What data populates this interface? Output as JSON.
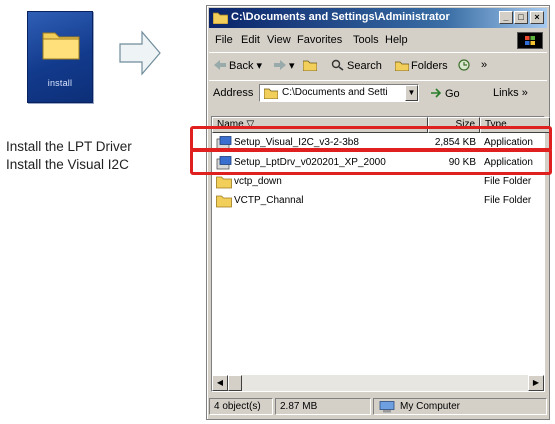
{
  "install_tile": {
    "label": "install"
  },
  "captions": [
    "Install the LPT Driver",
    "Install the Visual I2C"
  ],
  "window": {
    "title": "C:\\Documents and Settings\\Administrator",
    "menu": [
      "File",
      "Edit",
      "View",
      "Favorites",
      "Tools",
      "Help"
    ],
    "toolbar": {
      "back": "Back",
      "search": "Search",
      "folders": "Folders"
    },
    "address": {
      "label": "Address",
      "value": "C:\\Documents and Setti",
      "go": "Go",
      "links": "Links"
    },
    "columns": {
      "name": "Name",
      "size": "Size",
      "type": "Type"
    },
    "files": [
      {
        "name": "Setup_Visual_I2C_v3-2-3b8",
        "size": "2,854 KB",
        "type": "Application",
        "icon": "setup-icon"
      },
      {
        "name": "Setup_LptDrv_v020201_XP_2000",
        "size": "90 KB",
        "type": "Application",
        "icon": "setup-icon"
      },
      {
        "name": "vctp_down",
        "size": "",
        "type": "File Folder",
        "icon": "folder-icon"
      },
      {
        "name": "VCTP_Channal",
        "size": "",
        "type": "File Folder",
        "icon": "folder-icon"
      }
    ],
    "status": {
      "count": "4 object(s)",
      "size": "2.87 MB",
      "location": "My Computer"
    }
  },
  "colors": {
    "highlight": "#e0201f",
    "title_bar": "#0a246a",
    "tile": "#123a8c"
  }
}
